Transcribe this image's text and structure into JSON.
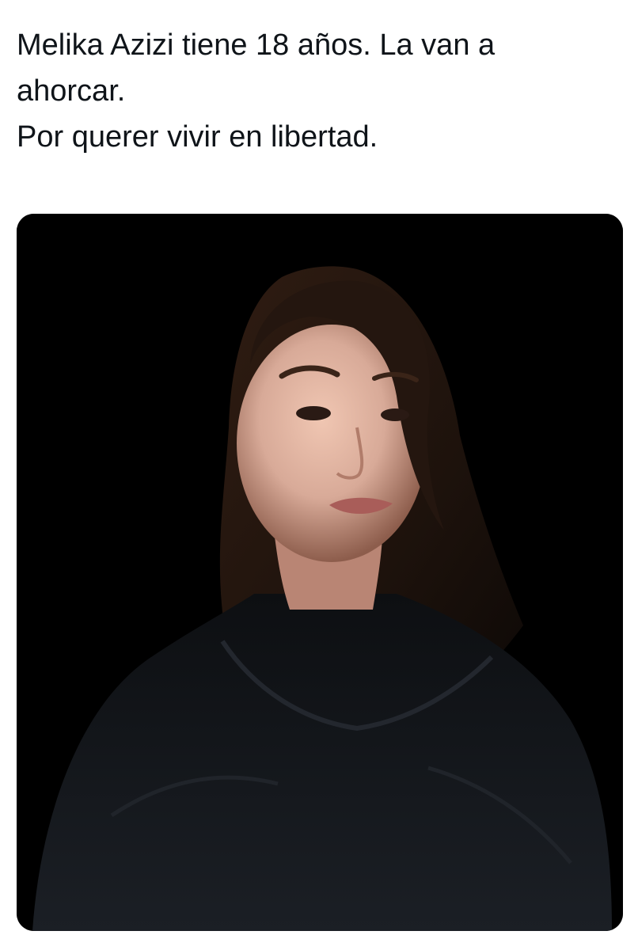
{
  "tweet": {
    "text_lines": [
      "Melika Azizi tiene 18 años. La van a",
      "ahorcar.",
      "Por querer vivir en libertad."
    ]
  },
  "media": {
    "type": "photo",
    "background_color": "#000000",
    "skin_color": "#d8aa98",
    "hair_color": "#26180f",
    "clothing_color": "#121418"
  }
}
